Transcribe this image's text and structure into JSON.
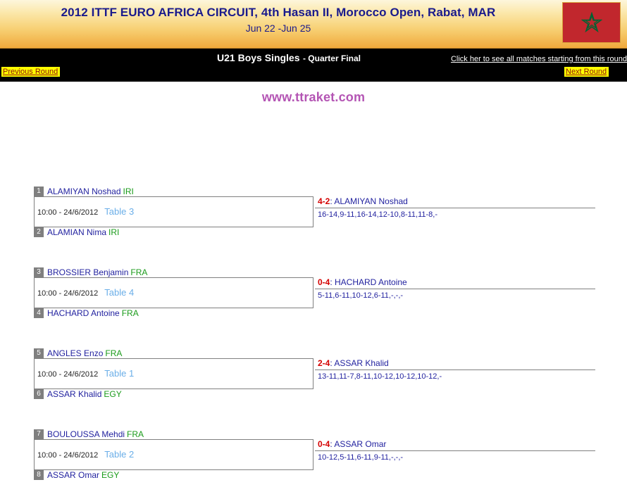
{
  "banner": {
    "title": "2012 ITTF EURO AFRICA CIRCUIT, 4th Hasan II, Morocco Open, Rabat, MAR",
    "dates": "Jun 22 -Jun 25",
    "flag_icon": "morocco-flag-icon",
    "flag_field_color": "#c1272d",
    "flag_star_color": "#006233"
  },
  "nav": {
    "category": "U21 Boys Singles",
    "round": "- Quarter Final",
    "all_matches_link": "Click her to see all matches starting from this round",
    "previous_round": "Previous Round",
    "next_round": "Next Round",
    "highlight_color": "#ffff00",
    "link_color": "#8b0a0a"
  },
  "watermark": {
    "text": "www.ttraket.com",
    "color": "#b455b4"
  },
  "matches": [
    {
      "top_player": {
        "seed": "1",
        "name": "ALAMIYAN Noshad",
        "country": "IRI"
      },
      "bottom_player": {
        "seed": "2",
        "name": "ALAMIAN Nima",
        "country": "IRI"
      },
      "time": "10:00 - 24/6/2012",
      "table": "Table 3",
      "score": "4-2",
      "winner": ": ALAMIYAN Noshad",
      "sets": "16-14,9-11,16-14,12-10,8-11,11-8,-"
    },
    {
      "top_player": {
        "seed": "3",
        "name": "BROSSIER Benjamin",
        "country": "FRA"
      },
      "bottom_player": {
        "seed": "4",
        "name": "HACHARD Antoine",
        "country": "FRA"
      },
      "time": "10:00 - 24/6/2012",
      "table": "Table 4",
      "score": "0-4",
      "winner": ": HACHARD Antoine",
      "sets": "5-11,6-11,10-12,6-11,-,-,-"
    },
    {
      "top_player": {
        "seed": "5",
        "name": "ANGLES Enzo",
        "country": "FRA"
      },
      "bottom_player": {
        "seed": "6",
        "name": "ASSAR Khalid",
        "country": "EGY"
      },
      "time": "10:00 - 24/6/2012",
      "table": "Table 1",
      "score": "2-4",
      "winner": ": ASSAR Khalid",
      "sets": "13-11,11-7,8-11,10-12,10-12,10-12,-"
    },
    {
      "top_player": {
        "seed": "7",
        "name": "BOULOUSSA Mehdi",
        "country": "FRA"
      },
      "bottom_player": {
        "seed": "8",
        "name": "ASSAR Omar",
        "country": "EGY"
      },
      "time": "10:00 - 24/6/2012",
      "table": "Table 2",
      "score": "0-4",
      "winner": ": ASSAR Omar",
      "sets": "10-12,5-11,6-11,9-11,-,-,-"
    }
  ]
}
